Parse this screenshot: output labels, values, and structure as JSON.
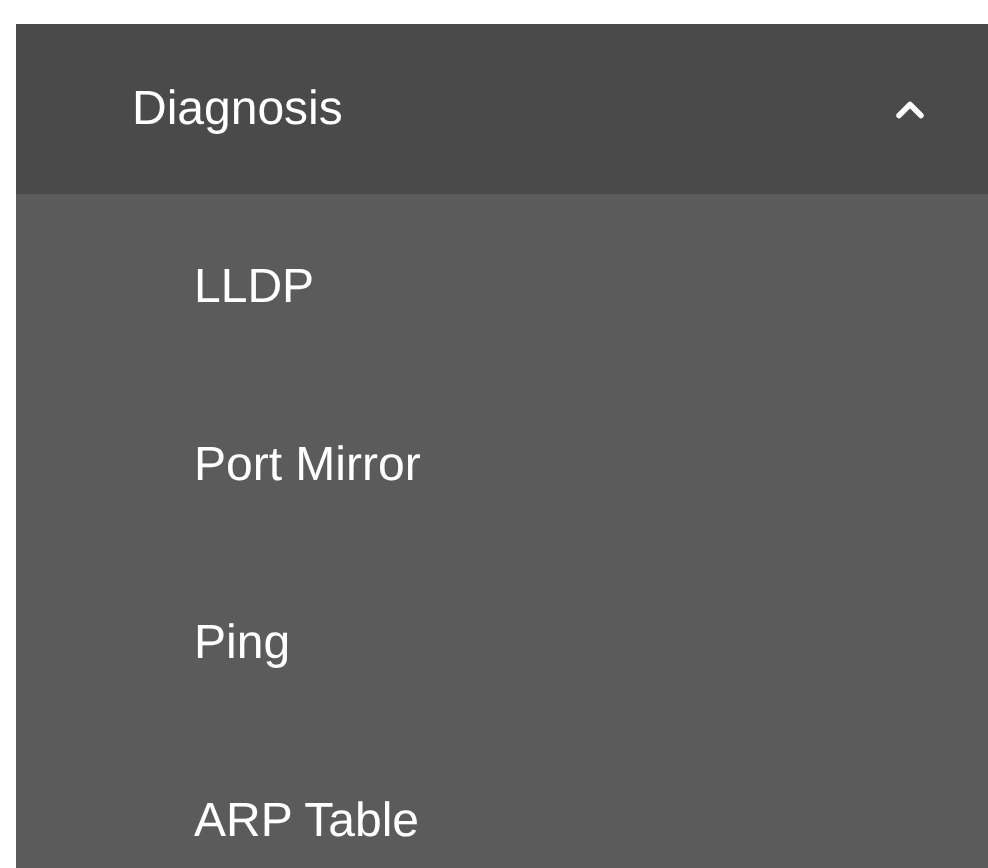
{
  "menu": {
    "title": "Diagnosis",
    "expanded": true,
    "items": [
      {
        "label": "LLDP"
      },
      {
        "label": "Port Mirror"
      },
      {
        "label": "Ping"
      },
      {
        "label": "ARP Table"
      }
    ]
  }
}
